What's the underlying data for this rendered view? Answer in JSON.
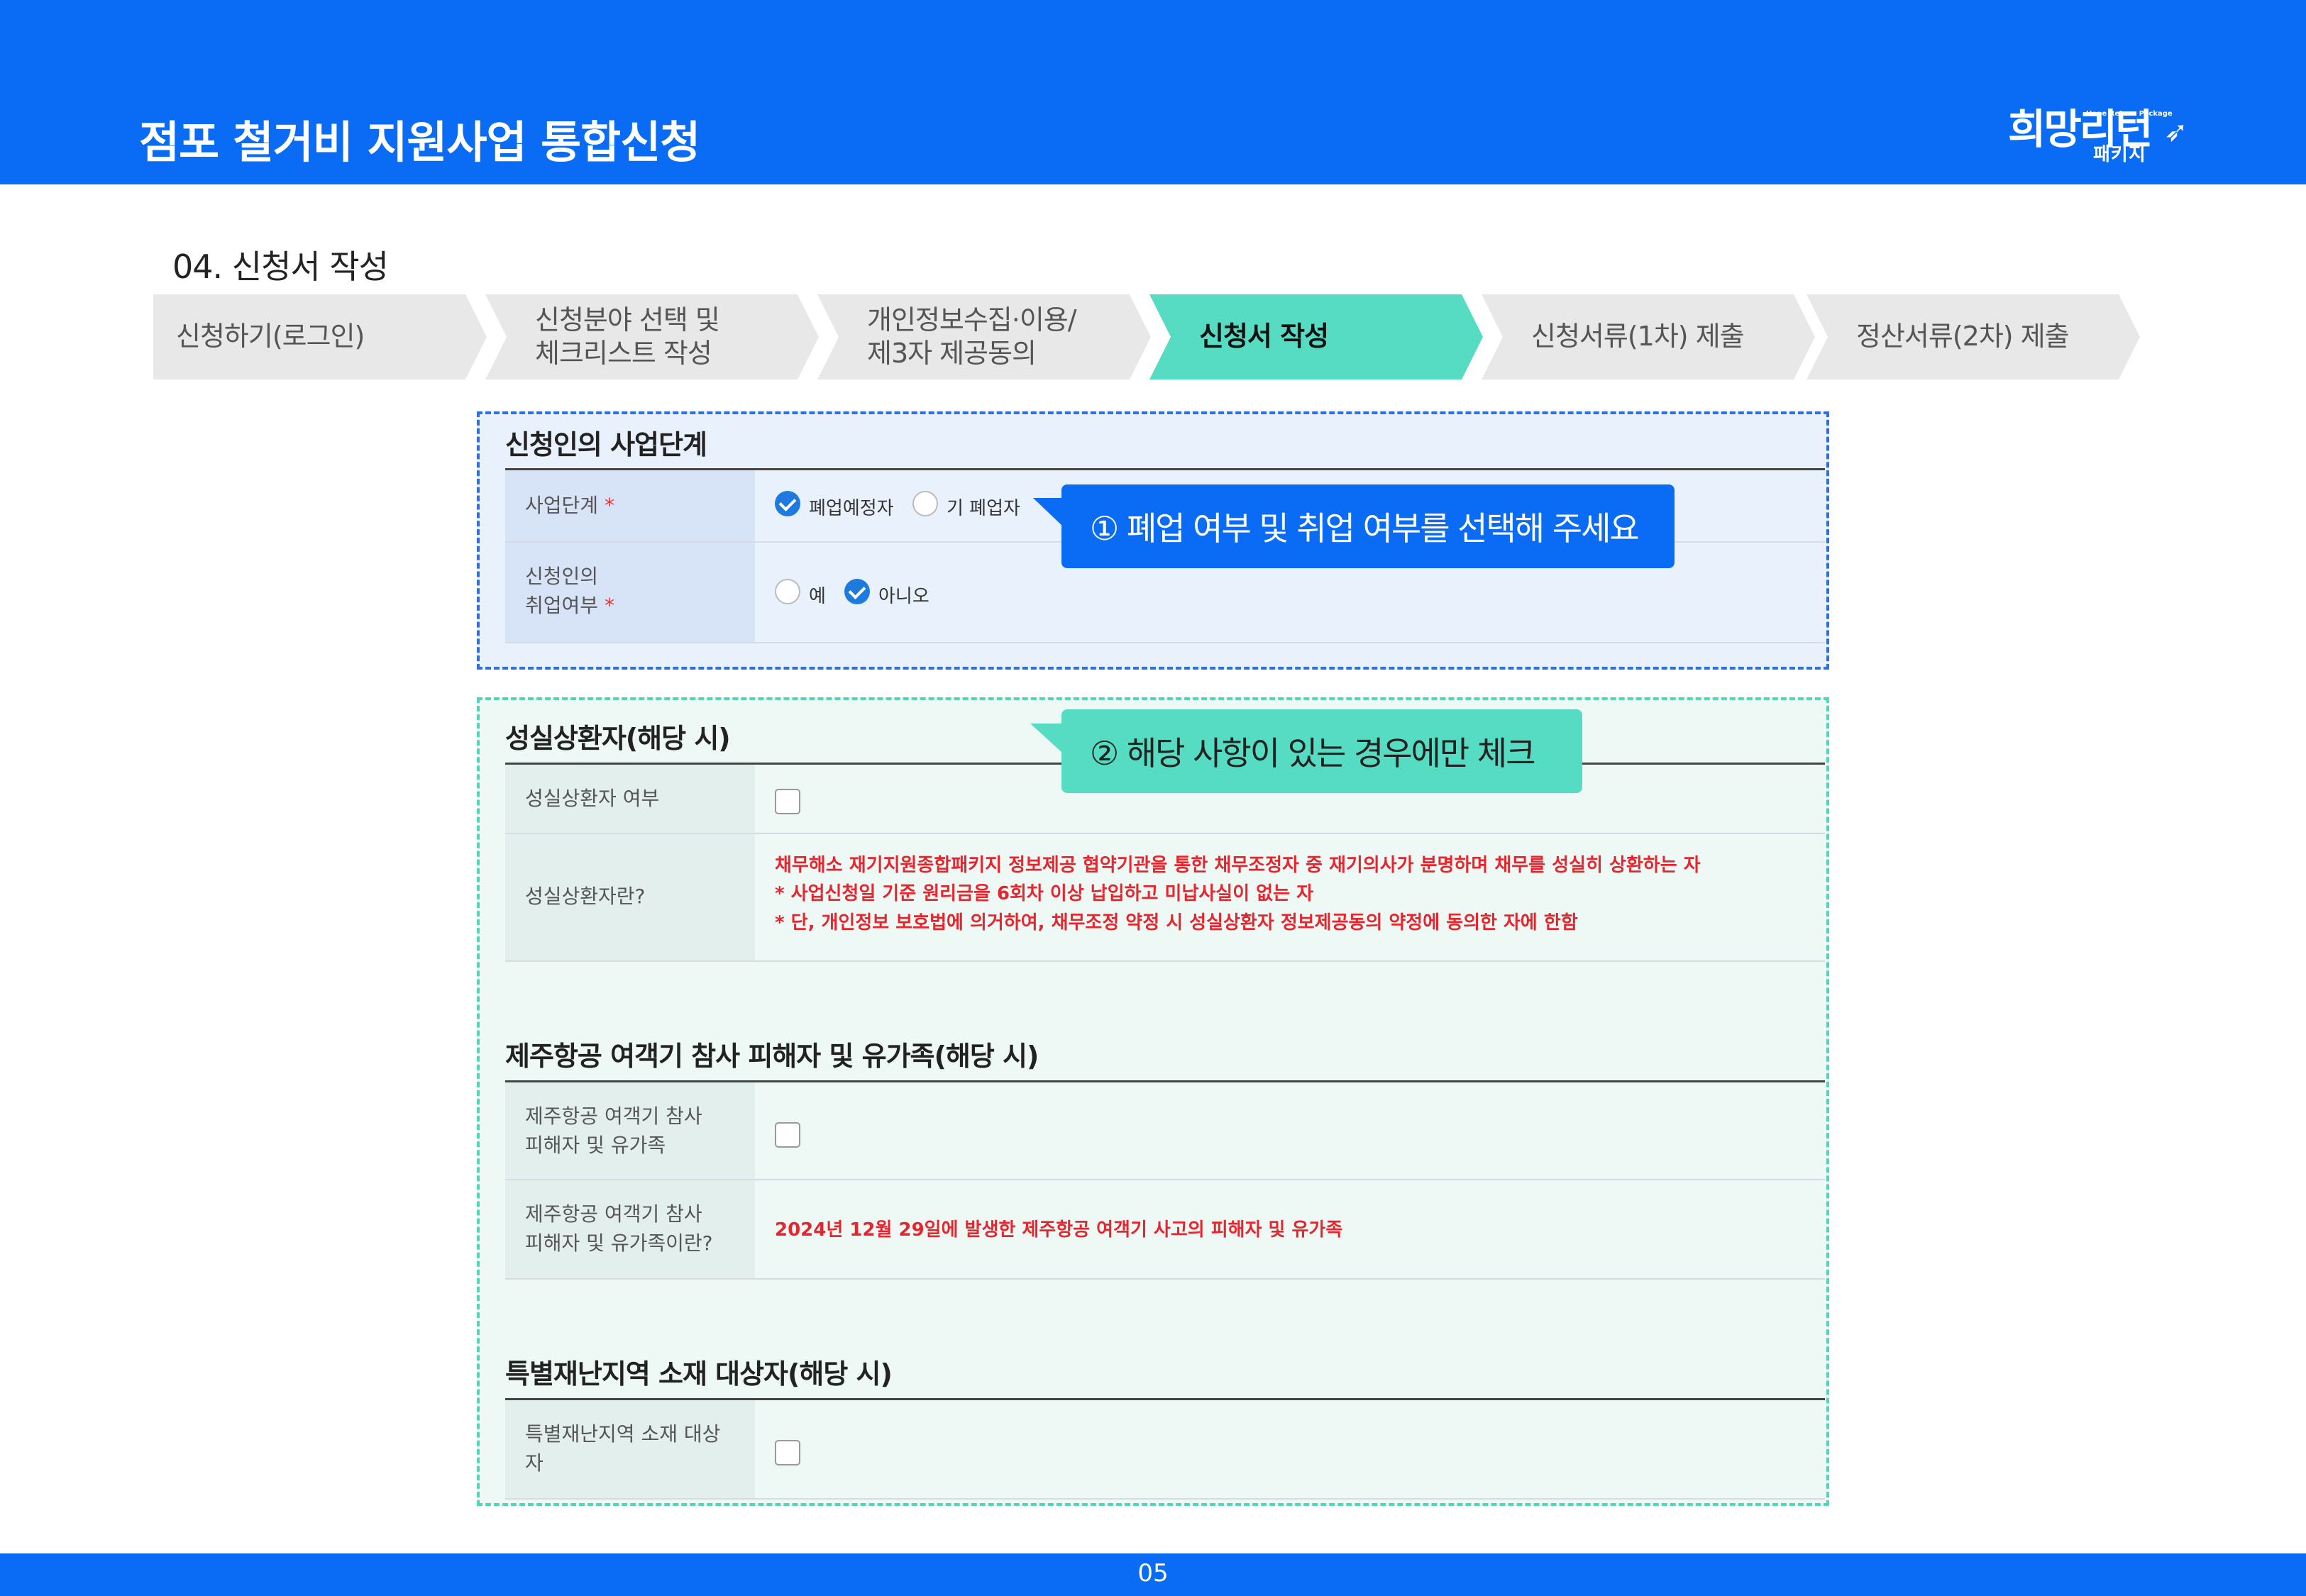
{
  "header": {
    "title": "점포 철거비 지원사업 통합신청"
  },
  "logo": {
    "main": "희망리턴",
    "eng": "Hope Return Package",
    "sub": "패키지"
  },
  "section_title": "04. 신청서 작성",
  "steps": [
    {
      "label": "신청하기(로그인)"
    },
    {
      "label": "신청분야 선택 및\n체크리스트 작성"
    },
    {
      "label": "개인정보수집·이용/\n제3자 제공동의"
    },
    {
      "label": "신청서 작성"
    },
    {
      "label": "신청서류(1차) 제출"
    },
    {
      "label": "정산서류(2차) 제출"
    }
  ],
  "business_stage": {
    "title": "신청인의 사업단계",
    "stage_label": "사업단계",
    "required_mark": "*",
    "options": [
      "폐업예정자",
      "기 폐업자"
    ],
    "employment_label": "신청인의\n취업여부",
    "employment_options": [
      "예",
      "아니오"
    ]
  },
  "callouts": {
    "one": "① 폐업 여부 및 취업 여부를 선택해 주세요",
    "two": "② 해당 사항이 있는 경우에만 체크"
  },
  "faithful_repayer": {
    "title": "성실상환자(해당 시)",
    "check_label": "성실상환자 여부",
    "def_label": "성실상환자란?",
    "def_text": "채무해소 재기지원종합패키지 정보제공 협약기관을 통한 채무조정자 중 재기의사가 분명하며 채무를 성실히 상환하는 자\n   * 사업신청일 기준 원리금을 6회차 이상 납입하고 미납사실이 없는 자\n   * 단, 개인정보 보호법에 의거하여, 채무조정 약정 시 성실상환자 정보제공동의 약정에 동의한 자에 한함"
  },
  "jeju_air": {
    "title": "제주항공 여객기 참사 피해자 및 유가족(해당 시)",
    "check_label": "제주항공 여객기 참사\n피해자 및 유가족",
    "def_label": "제주항공 여객기 참사\n피해자 및 유가족이란?",
    "def_text": "2024년 12월 29일에 발생한 제주항공 여객기 사고의 피해자 및 유가족"
  },
  "disaster_area": {
    "title": "특별재난지역 소재 대상자(해당 시)",
    "check_label": "특별재난지역 소재 대상\n자"
  },
  "footer": {
    "page": "05"
  },
  "colors": {
    "brand_blue": "#0a6cf5",
    "mint": "#56dcc2",
    "required_red": "#e5262f"
  }
}
